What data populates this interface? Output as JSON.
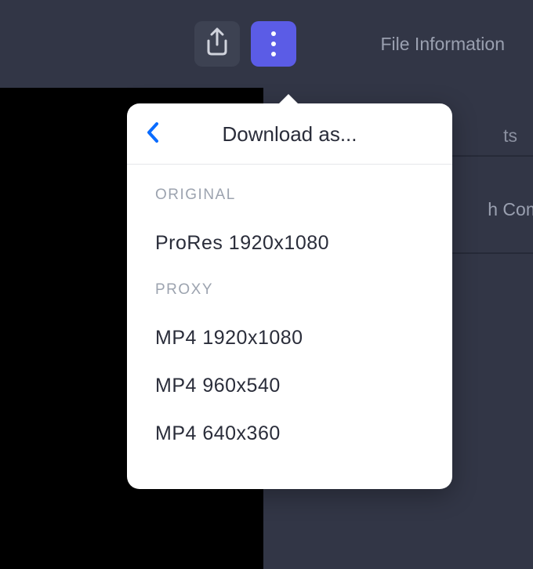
{
  "header": {
    "file_info_label": "File Information"
  },
  "right_panel": {
    "tab_partial": "ts",
    "comments_partial": "h Com"
  },
  "dropdown": {
    "title": "Download as...",
    "sections": [
      {
        "label": "ORIGINAL",
        "options": [
          {
            "text": "ProRes 1920x1080"
          }
        ]
      },
      {
        "label": "PROXY",
        "options": [
          {
            "text": "MP4 1920x1080"
          },
          {
            "text": "MP4 960x540"
          },
          {
            "text": "MP4 640x360"
          }
        ]
      }
    ]
  }
}
